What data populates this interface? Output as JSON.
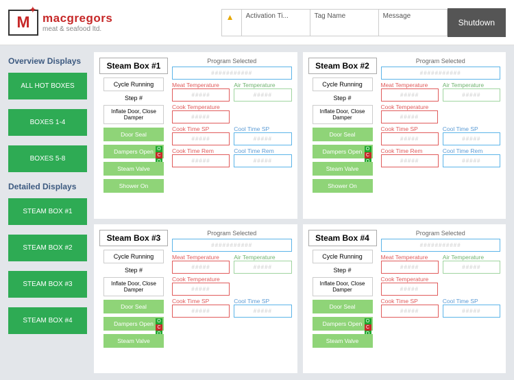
{
  "logo": {
    "name": "macgregors",
    "tag": "meat & seafood ltd."
  },
  "header": {
    "col1": "Activation Ti...",
    "col2": "Tag Name",
    "col3": "Message",
    "shutdown": "Shutdown"
  },
  "sidebar": {
    "title1": "Overview Displays",
    "overview": [
      "ALL HOT BOXES",
      "BOXES 1-4",
      "BOXES 5-8"
    ],
    "title2": "Detailed Displays",
    "detailed": [
      "STEAM BOX #1",
      "STEAM BOX #2",
      "STEAM BOX #3",
      "STEAM BOX #4"
    ]
  },
  "panels": [
    {
      "title": "Steam Box #1"
    },
    {
      "title": "Steam Box #2"
    },
    {
      "title": "Steam Box #3"
    },
    {
      "title": "Steam Box #4"
    }
  ],
  "labels": {
    "cycle": "Cycle Running",
    "step": "Step #",
    "inflate": "Inflate Door, Close Damper",
    "door": "Door Seal",
    "dampers": "Dampers Open",
    "steam": "Steam Valve",
    "shower": "Shower On",
    "prog": "Program Selected",
    "meat": "Meat Temperature",
    "air": "Air Temperature",
    "cook": "Cook Temperature",
    "cooksp": "Cook Time SP",
    "coolsp": "Cool Time SP",
    "cookrem": "Cook Time Rem",
    "coolrem": "Cool Time Rem",
    "o": "O",
    "c": "C",
    "ph_long": "###########",
    "ph": "#####"
  }
}
